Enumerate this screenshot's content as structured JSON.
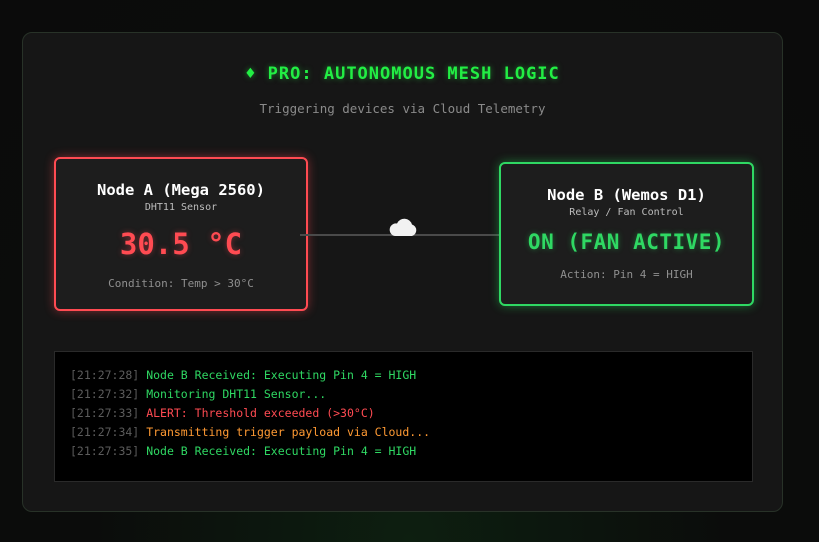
{
  "header": {
    "title": "♦ PRO: AUTONOMOUS MESH LOGIC",
    "subtitle": "Triggering devices via Cloud Telemetry"
  },
  "node_a": {
    "name": "Node A (Mega 2560)",
    "sensor": "DHT11 Sensor",
    "reading": "30.5 °C",
    "condition": "Condition: Temp > 30°C",
    "accent_color": "#ff4b52"
  },
  "link": {
    "icon": "cloud-icon"
  },
  "node_b": {
    "name": "Node B (Wemos D1)",
    "role": "Relay / Fan Control",
    "state": "ON (FAN ACTIVE)",
    "action": "Action: Pin 4 = HIGH",
    "accent_color": "#2fd863"
  },
  "console": {
    "lines": [
      {
        "time": "[21:27:28]",
        "message": "Node B Received: Executing Pin 4 = HIGH",
        "color": "#2fd863"
      },
      {
        "time": "[21:27:32]",
        "message": "Monitoring DHT11 Sensor...",
        "color": "#2fd863"
      },
      {
        "time": "[21:27:33]",
        "message": "ALERT: Threshold exceeded (>30°C)",
        "color": "#ff4b52"
      },
      {
        "time": "[21:27:34]",
        "message": "Transmitting trigger payload via Cloud...",
        "color": "#ff9a33"
      },
      {
        "time": "[21:27:35]",
        "message": "Node B Received: Executing Pin 4 = HIGH",
        "color": "#2fd863"
      }
    ]
  }
}
